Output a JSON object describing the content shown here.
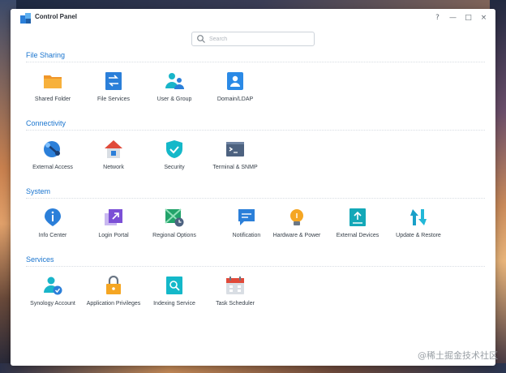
{
  "window": {
    "title": "Control Panel"
  },
  "controls": {
    "help": "?",
    "minimize": "—",
    "maximize": "□",
    "close": "×"
  },
  "search": {
    "placeholder": "Search"
  },
  "sections": {
    "file_sharing": {
      "title": "File Sharing",
      "items": [
        {
          "label": "Shared Folder",
          "icon": "folder-icon",
          "color": "#f5a623"
        },
        {
          "label": "File Services",
          "icon": "file-services-icon",
          "color": "#2b7fd9"
        },
        {
          "label": "User & Group",
          "icon": "user-group-icon",
          "color": "#19b5c9"
        },
        {
          "label": "Domain/LDAP",
          "icon": "domain-icon",
          "color": "#2b8ae6"
        }
      ]
    },
    "connectivity": {
      "title": "Connectivity",
      "items": [
        {
          "label": "External Access",
          "icon": "external-access-icon",
          "color": "#2b7fd9"
        },
        {
          "label": "Network",
          "icon": "network-house-icon",
          "color": "#e04a3a"
        },
        {
          "label": "Security",
          "icon": "shield-icon",
          "color": "#14b8c9"
        },
        {
          "label": "Terminal & SNMP",
          "icon": "terminal-icon",
          "color": "#4d6280"
        }
      ]
    },
    "system": {
      "title": "System",
      "items": [
        {
          "label": "Info Center",
          "icon": "info-icon",
          "color": "#2b7fd9"
        },
        {
          "label": "Login Portal",
          "icon": "login-portal-icon",
          "color": "#7b4fd6"
        },
        {
          "label": "Regional Options",
          "icon": "regional-options-icon",
          "color": "#22a36a"
        },
        {
          "label": "Notification",
          "icon": "notification-icon",
          "color": "#2b7fd9"
        },
        {
          "label": "Hardware & Power",
          "icon": "bulb-icon",
          "color": "#f5a623"
        },
        {
          "label": "External Devices",
          "icon": "external-devices-icon",
          "color": "#13a8b8"
        },
        {
          "label": "Update & Restore",
          "icon": "update-icon",
          "color": "#1aa0c8"
        }
      ]
    },
    "services": {
      "title": "Services",
      "items": [
        {
          "label": "Synology Account",
          "icon": "synology-account-icon",
          "color": "#19b5c9"
        },
        {
          "label": "Application Privileges",
          "icon": "lock-icon",
          "color": "#f5a623"
        },
        {
          "label": "Indexing Service",
          "icon": "indexing-icon",
          "color": "#14b8c9"
        },
        {
          "label": "Task Scheduler",
          "icon": "calendar-icon",
          "color": "#e04a3a"
        }
      ]
    }
  },
  "watermark": "@稀土掘金技术社区"
}
